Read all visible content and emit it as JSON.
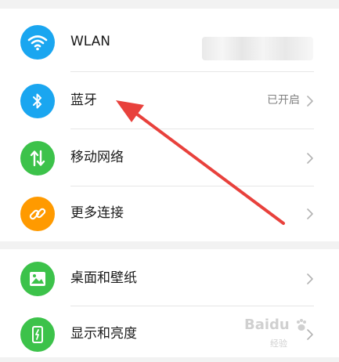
{
  "settings": {
    "items": [
      {
        "label": "WLAN",
        "icon": "wifi-icon",
        "color": "#1aa6f0"
      },
      {
        "label": "蓝牙",
        "status": "已开启",
        "icon": "bluetooth-icon",
        "color": "#1aa6f0"
      },
      {
        "label": "移动网络",
        "icon": "mobile-data-icon",
        "color": "#3cc24a"
      },
      {
        "label": "更多连接",
        "icon": "link-icon",
        "color": "#ff9a00"
      },
      {
        "label": "桌面和壁纸",
        "icon": "wallpaper-icon",
        "color": "#3cc24a"
      },
      {
        "label": "显示和亮度",
        "icon": "display-brightness-icon",
        "color": "#3cc24a"
      }
    ]
  },
  "watermark": {
    "text": "Baidu",
    "sub": "经验"
  },
  "colors": {
    "arrow": "#e8413c",
    "chevron": "#b3b3b3"
  }
}
